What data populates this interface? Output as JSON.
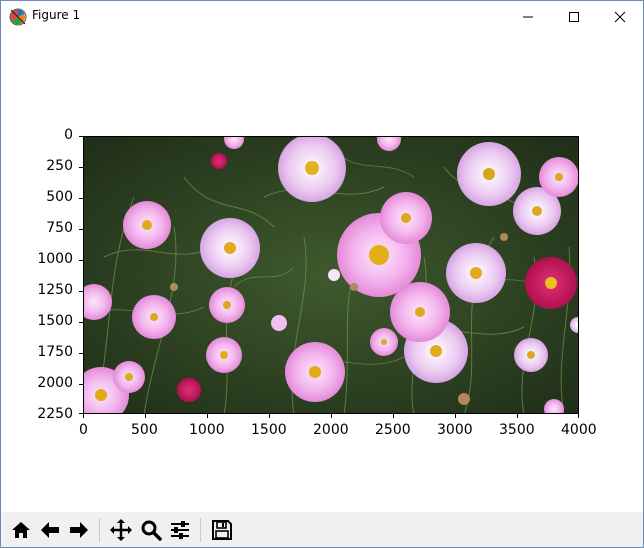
{
  "window": {
    "title": "Figure 1",
    "icon": "matplotlib-figure-icon",
    "controls": [
      "minimize-icon",
      "maximize-icon",
      "close-icon"
    ]
  },
  "plot": {
    "image": "photo of pink, light-purple and magenta cosmos flowers among green foliage",
    "xlim": [
      0,
      4000
    ],
    "ylim": [
      2250,
      0
    ],
    "x_ticks": [
      "0",
      "500",
      "1000",
      "1500",
      "2000",
      "2500",
      "3000",
      "3500",
      "4000"
    ],
    "y_ticks": [
      "0",
      "250",
      "500",
      "750",
      "1000",
      "1250",
      "1500",
      "1750",
      "2000",
      "2250"
    ]
  },
  "toolbar": {
    "buttons": [
      "home-icon",
      "back-icon",
      "forward-icon",
      "pan-icon",
      "zoom-icon",
      "configure-subplots-icon",
      "save-icon"
    ]
  }
}
